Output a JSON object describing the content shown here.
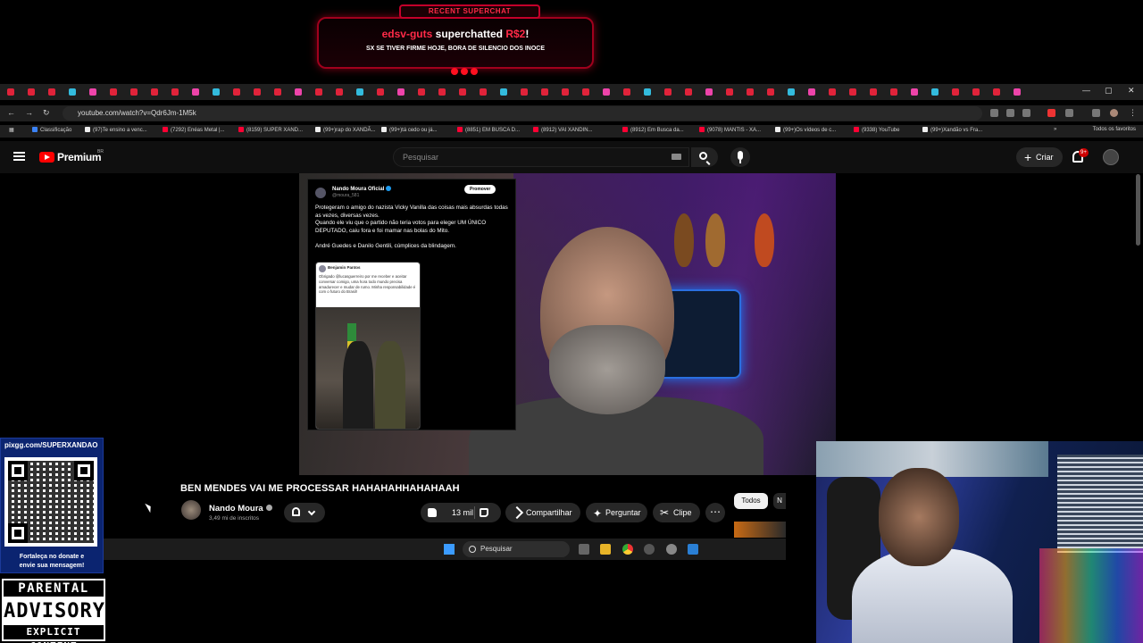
{
  "superchat": {
    "tag": "RECENT SUPERCHAT",
    "user": "edsv-guts",
    "action": " superchatted ",
    "amount": "R$2",
    "excl": "!",
    "message": "SX SE TIVER FIRME HOJE, BORA DE SILENCIO DOS INOCE"
  },
  "browser": {
    "url": "youtube.com/watch?v=Qdr6Jm-1M5k",
    "bookmarks": [
      {
        "label": "Classificação",
        "color": "#3b82f6"
      },
      {
        "label": "(97)Te ensino a venc...",
        "color": "#eeeeee"
      },
      {
        "label": "(7292) Enéas Metal |...",
        "color": "#ff0033"
      },
      {
        "label": "(8159) SUPER XAND...",
        "color": "#ff0033"
      },
      {
        "label": "(99+)rap do XANDÃ...",
        "color": "#eeeeee"
      },
      {
        "label": "(99+)tá cedo ou já...",
        "color": "#eeeeee"
      },
      {
        "label": "(8851) EM BUSCA D...",
        "color": "#ff0033"
      },
      {
        "label": "(8912) VAI XANDIN...",
        "color": "#ff0033"
      },
      {
        "label": "(8912) Em Busca da...",
        "color": "#ff0033"
      },
      {
        "label": "(9078) MANTIS - XA...",
        "color": "#ff0033"
      },
      {
        "label": "(99+)Os vídeos de c...",
        "color": "#eeeeee"
      },
      {
        "label": "(9338) YouTube",
        "color": "#ff0033"
      },
      {
        "label": "(99+)Xandão vs Fra...",
        "color": "#eeeeee"
      }
    ],
    "all_bookmarks": "Todos os favoritos"
  },
  "youtube": {
    "brand": "Premium",
    "region": "BR",
    "search_placeholder": "Pesquisar",
    "create_label": "Criar",
    "notif_count": "9+"
  },
  "tweet": {
    "name": "Nando Moura Oficial",
    "handle": "@moura_581",
    "promote": "Promover",
    "para1": "Protegeram o amigo do nazista Vicky Vanilla das coisas mais absurdas todas as vezes, diversas vezes.",
    "para2": "Quando ele viu que o partido não teria votos para eleger UM ÚNICO DEPUTADO, caiu fora e foi mamar nas bolas do Mito.",
    "para3": "André Guedes e Danilo Gentili, cúmplices da blindagem.",
    "quote_name": "Benjamin Pantos",
    "quote_text": "Obrigado @lucasguerreiro por me receber e aceitar conversar comigo, uma hora todo mundo precisa amadurecer e mudar de rumo. Minha responsabilidade é com o futuro do Brasil!"
  },
  "video": {
    "title": "BEN MENDES VAI ME PROCESSAR HAHAHAHHAHAHAAH",
    "channel": "Nando Moura",
    "subscribers": "3,49 mi de inscritos",
    "likes": "13 mil",
    "share": "Compartilhar",
    "ask": "Perguntar",
    "clip": "Clipe",
    "more": "⋯",
    "chip_all": "Todos",
    "chip_next": "N"
  },
  "taskbar": {
    "search": "Pesquisar"
  },
  "overlay": {
    "donate_url": "pixgg.com/SUPERXANDAO",
    "donate_msg1": "Fortaleça no donate e",
    "donate_msg2": "envie sua mensagem!",
    "advisory1": "PARENTAL",
    "advisory2": "ADVISORY",
    "advisory3": "EXPLICIT CONTENT"
  }
}
